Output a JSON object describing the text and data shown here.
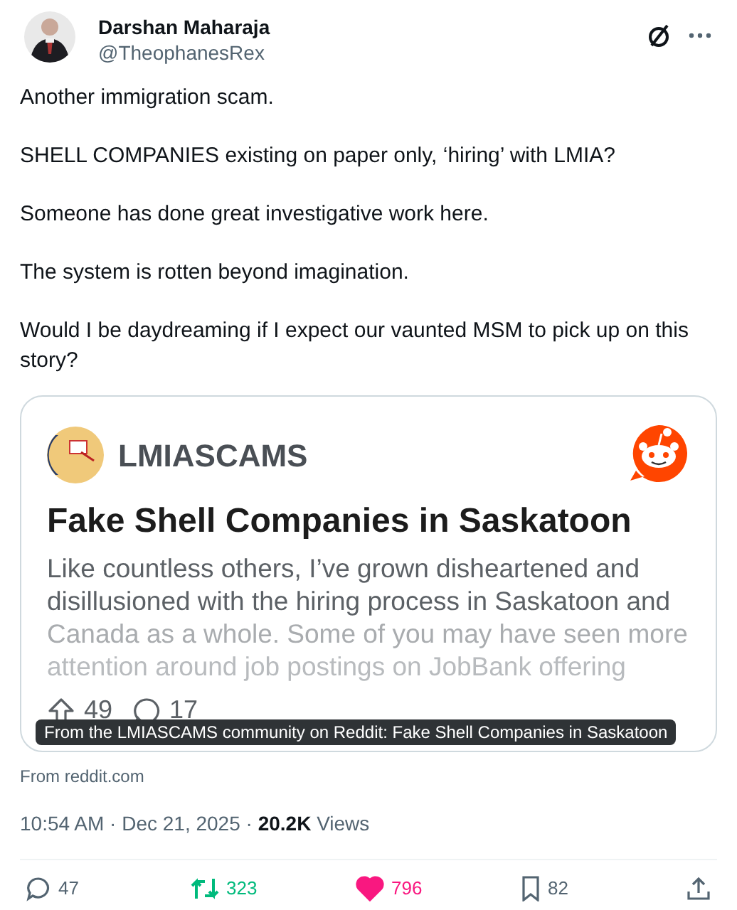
{
  "author": {
    "name": "Darshan Maharaja",
    "handle": "@TheophanesRex"
  },
  "paragraphs": [
    "Another immigration scam.",
    "SHELL COMPANIES existing on paper only, ‘hiring’ with LMIA?",
    "Someone has done great investigative work here.",
    "The system is rotten beyond imagination.",
    "Would I be daydreaming if I expect our vaunted MSM to pick up on this story?"
  ],
  "link_card": {
    "community": "LMIASCAMS",
    "title": "Fake Shell Companies in Saskatoon",
    "excerpt": [
      "Like countless others, I’ve grown disheartened and disillusioned with the hiring process in Saskatoon and",
      "Canada as a whole. Some of you may have seen more",
      "attention around job postings on JobBank offering"
    ],
    "upvotes": "49",
    "comments": "17",
    "tooltip": "From the LMIASCAMS community on Reddit: Fake Shell Companies in Saskatoon"
  },
  "source": "From reddit.com",
  "meta": {
    "time": "10:54 AM · Dec 21, 2025 · ",
    "views_count": "20.2K",
    "views_label": "Views"
  },
  "actions": [
    {
      "kind": "reply",
      "count": "47",
      "active": false
    },
    {
      "kind": "repost",
      "count": "323",
      "active": true
    },
    {
      "kind": "like",
      "count": "796",
      "active": true
    },
    {
      "kind": "bookmark",
      "count": "82",
      "active": false
    },
    {
      "kind": "share",
      "active": false
    }
  ]
}
